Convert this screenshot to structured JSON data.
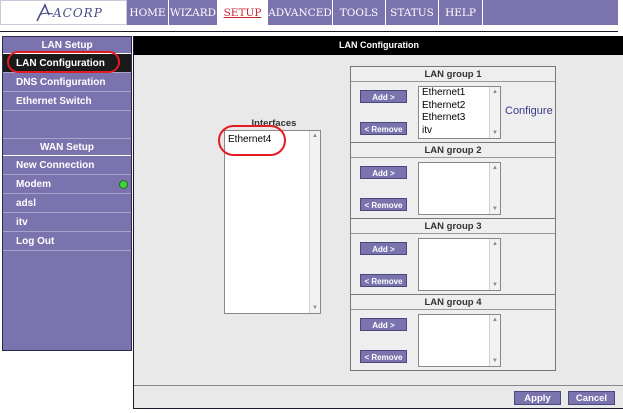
{
  "logo": {
    "text": "ACORP"
  },
  "nav": {
    "tabs": [
      {
        "label": "HOME",
        "active": false
      },
      {
        "label": "WIZARD",
        "active": false
      },
      {
        "label": "SETUP",
        "active": true
      },
      {
        "label": "ADVANCED",
        "active": false
      },
      {
        "label": "TOOLS",
        "active": false
      },
      {
        "label": "STATUS",
        "active": false
      },
      {
        "label": "HELP",
        "active": false
      }
    ]
  },
  "sidebar": {
    "lan_header": "LAN Setup",
    "lan_items": [
      "LAN Configuration",
      "DNS Configuration",
      "Ethernet Switch"
    ],
    "wan_header": "WAN Setup",
    "wan_items": [
      "New Connection",
      "Modem",
      "adsl",
      "itv",
      "Log Out"
    ],
    "modem_status_color": "#3fd13f"
  },
  "main": {
    "title": "LAN Configuration",
    "interfaces_label": "Interfaces",
    "interfaces": [
      "Ethernet4"
    ],
    "groups": [
      {
        "title": "LAN group 1",
        "members": [
          "Ethernet1",
          "Ethernet2",
          "Ethernet3",
          "itv"
        ],
        "configure": "Configure"
      },
      {
        "title": "LAN group 2",
        "members": []
      },
      {
        "title": "LAN group 3",
        "members": []
      },
      {
        "title": "LAN group 4",
        "members": []
      }
    ],
    "add_label": "Add >",
    "remove_label": "< Remove",
    "apply_label": "Apply",
    "cancel_label": "Cancel"
  },
  "colors": {
    "accent": "#7b73ad",
    "active_tab_text": "#cc2233",
    "annotation": "#e41c22"
  }
}
